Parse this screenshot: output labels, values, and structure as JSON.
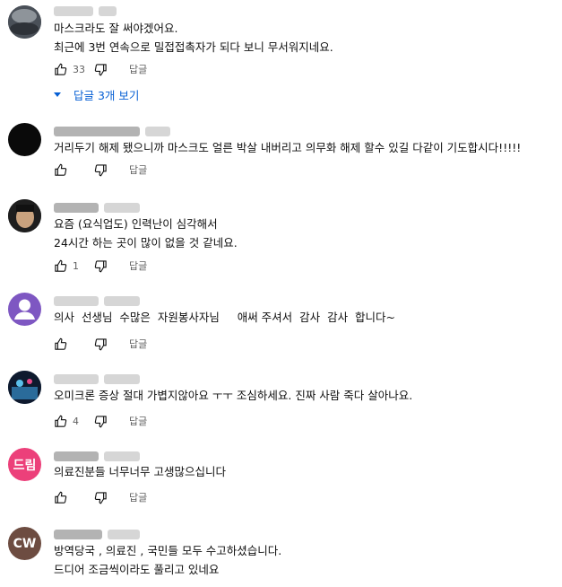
{
  "comments": [
    {
      "avatar_initials": "",
      "avatar_color": "#555d66",
      "lines": [
        "마스크라도 잘 써야겠어요.",
        "최근에 3번 연속으로 밀접접촉자가 되다 보니 무서워지네요."
      ],
      "like_count": "33",
      "reply_label": "답글",
      "replies_toggle": "답글 3개 보기"
    },
    {
      "avatar_initials": "",
      "avatar_color": "#0a0a0a",
      "lines": [
        "거리두기 해제 됐으니까 마스크도 얼른 박살 내버리고 의무화 해제 할수 있길 다같이 기도합시다!!!!!"
      ],
      "like_count": "",
      "reply_label": "답글"
    },
    {
      "avatar_initials": "",
      "avatar_color": "#3a3a3a",
      "lines": [
        "요즘 (요식업도) 인력난이 심각해서",
        "24시간 하는 곳이 많이 없을 것 같네요."
      ],
      "like_count": "1",
      "reply_label": "답글"
    },
    {
      "avatar_initials": "",
      "avatar_color": "#7e57c2",
      "lines": [
        "의사  선생님  수많은  자원봉사자님     애써 주셔서  감사  감사  합니다~"
      ],
      "like_count": "",
      "reply_label": "답글"
    },
    {
      "avatar_initials": "",
      "avatar_color": "#1f3a5a",
      "lines": [
        "오미크론 증상 절대 가볍지않아요 ㅜㅜ 조심하세요. 진짜 사람 죽다 살아나요."
      ],
      "like_count": "4",
      "reply_label": "답글"
    },
    {
      "avatar_initials": "드림",
      "avatar_color": "#ec407a",
      "lines": [
        "의료진분들 너무너무 고생많으십니다"
      ],
      "like_count": "",
      "reply_label": "답글"
    },
    {
      "avatar_initials": "CW",
      "avatar_color": "#6d4c41",
      "lines": [
        "방역당국 , 의료진 , 국민들 모두 수고하셨습니다.",
        "드디어 조금씩이라도 풀리고 있네요"
      ],
      "like_count": "",
      "reply_label": "답글"
    }
  ]
}
